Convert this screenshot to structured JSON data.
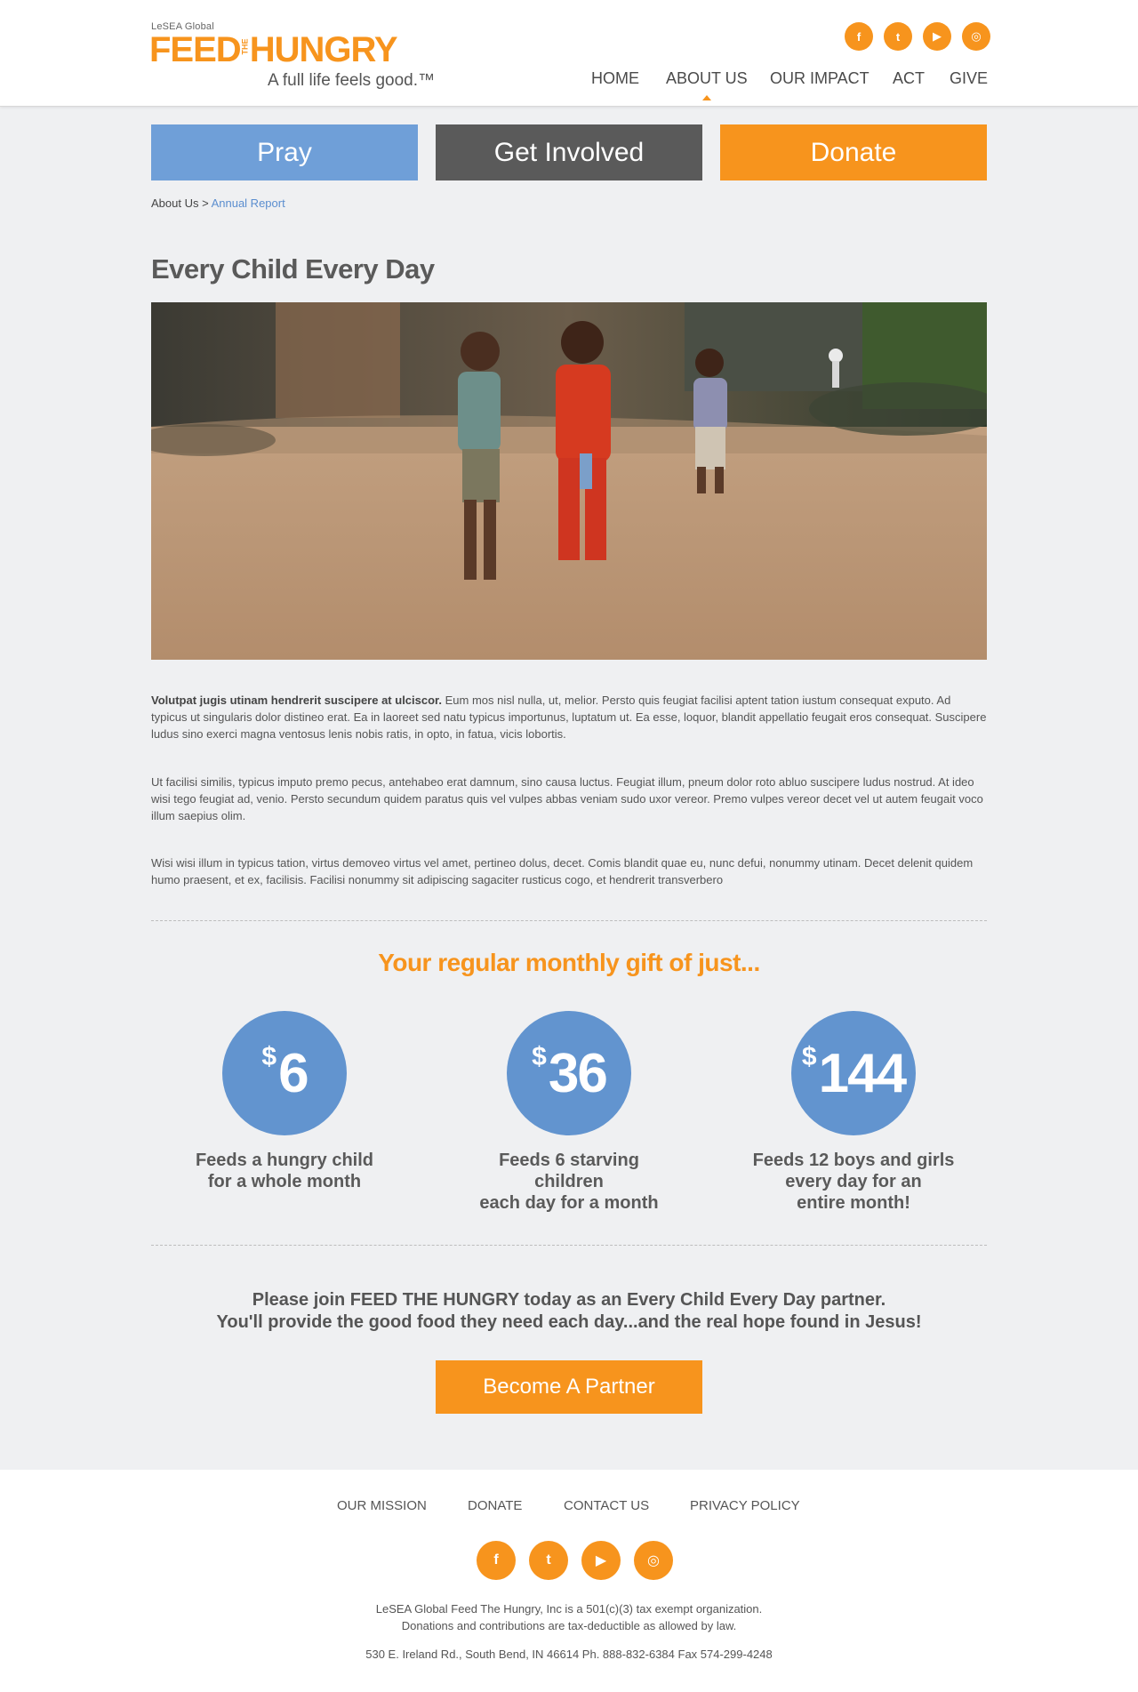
{
  "logo": {
    "small": "LeSEA Global",
    "feed": "FEED",
    "the": "THE",
    "hungry": "HUNGRY",
    "tagline": "A full life feels good.™"
  },
  "social": [
    "f",
    "t",
    "▶",
    "◎"
  ],
  "nav": {
    "items": [
      {
        "label": "HOME"
      },
      {
        "label": "ABOUT US"
      },
      {
        "label": "OUR IMPACT"
      },
      {
        "label": "ACT"
      },
      {
        "label": "GIVE"
      }
    ]
  },
  "actions": {
    "pray": "Pray",
    "involved": "Get Involved",
    "donate": "Donate"
  },
  "breadcrumb": {
    "parent": "About Us",
    "separator": " > ",
    "current": "Annual Report"
  },
  "title": "Every Child Every Day",
  "paragraphs": {
    "p1_bold": "Volutpat jugis utinam hendrerit suscipere at ulciscor.",
    "p1_rest": " Eum mos nisl nulla, ut, melior. Persto quis feugiat facilisi aptent tation iustum consequat exputo. Ad typicus ut singularis dolor distineo erat. Ea in laoreet sed natu typicus importunus, luptatum ut. Ea esse, loquor, blandit appellatio feugait eros consequat. Suscipere ludus sino exerci magna ventosus lenis nobis ratis, in opto, in fatua, vicis lobortis.",
    "p2": "Ut facilisi similis, typicus imputo premo pecus, antehabeo erat damnum, sino causa luctus. Feugiat illum, pneum dolor roto abluo suscipere ludus nostrud. At ideo wisi tego feugiat ad, venio. Persto secundum quidem paratus quis vel vulpes abbas veniam sudo uxor vereor. Premo vulpes vereor decet vel ut autem feugait voco illum saepius olim.",
    "p3": "Wisi wisi illum in typicus tation, virtus demoveo virtus vel amet, pertineo dolus, decet. Comis blandit quae eu, nunc defui, nonummy utinam. Decet delenit quidem humo praesent, et ex, facilisis. Facilisi nonummy sit adipiscing sagaciter rusticus cogo, et hendrerit transverbero"
  },
  "gifts": {
    "heading": "Your regular monthly gift of just...",
    "items": [
      {
        "dollar": "$",
        "amount": "6",
        "line1": "Feeds a hungry child",
        "line2": "for a whole month",
        "line3": ""
      },
      {
        "dollar": "$",
        "amount": "36",
        "line1": "Feeds 6 starving children",
        "line2": "each day for a month",
        "line3": ""
      },
      {
        "dollar": "$",
        "amount": "144",
        "line1": "Feeds 12 boys and girls",
        "line2": "every day for an",
        "line3": "entire month!"
      }
    ]
  },
  "partner": {
    "line1": "Please join FEED THE HUNGRY today as an Every Child Every Day partner.",
    "line2": "You'll provide the good food they need each day...and the real hope found in Jesus!",
    "button": "Become A Partner"
  },
  "footer": {
    "links": [
      {
        "label": "OUR MISSION"
      },
      {
        "label": "DONATE"
      },
      {
        "label": "CONTACT US"
      },
      {
        "label": "PRIVACY POLICY"
      }
    ],
    "line1": "LeSEA Global Feed The Hungry, Inc is a 501(c)(3) tax exempt organization.",
    "line2": "Donations and contributions are tax-deductible as allowed by law.",
    "line3": "530 E. Ireland Rd., South Bend, IN 46614   Ph. 888-832-6384   Fax 574-299-4248"
  },
  "colors": {
    "brand_orange": "#f7941d",
    "brand_blue": "#6f9fd8",
    "circle_blue": "#6294cf",
    "dark_button": "#5a5a5a",
    "background": "#eff0f2"
  },
  "icons": {
    "social": [
      "facebook-icon",
      "twitter-icon",
      "youtube-icon",
      "instagram-icon"
    ]
  }
}
